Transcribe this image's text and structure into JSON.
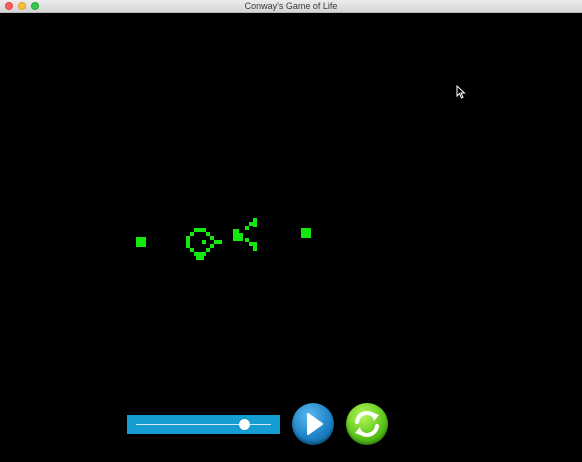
{
  "window": {
    "title": "Conway's Game of Life"
  },
  "colors": {
    "background": "#000000",
    "live_cell": "#13e80f",
    "slider": "#169dd1",
    "play_button": "#1d84c7",
    "reset_button": "#5cc91b"
  },
  "controls": {
    "speed_slider": {
      "value_fraction": 0.81
    },
    "play_button": {
      "icon": "play-icon"
    },
    "reset_button": {
      "icon": "refresh-icon"
    }
  }
}
